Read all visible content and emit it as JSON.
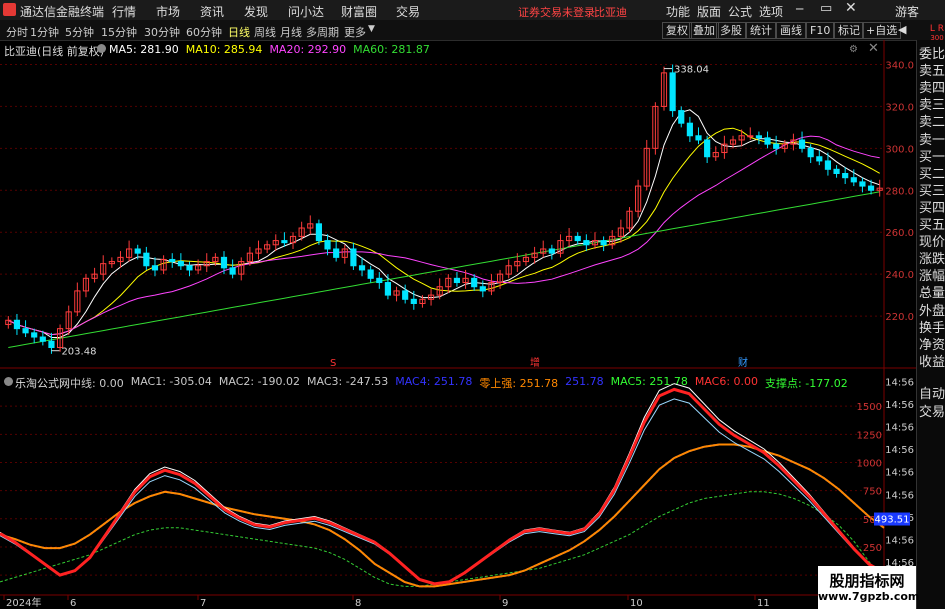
{
  "menu": {
    "app_title": "通达信金融终端",
    "items": [
      "行情",
      "市场",
      "资讯",
      "发现",
      "问小达",
      "财富圈",
      "交易"
    ],
    "notice": "证券交易未登录",
    "stock_name": "比亚迪",
    "right_items": [
      "功能",
      "版面",
      "公式",
      "选项"
    ],
    "guest": "游客",
    "lr_mark": "L R",
    "lr_num": "300"
  },
  "toolbar": {
    "timeframes": [
      "分时",
      "1分钟",
      "5分钟",
      "15分钟",
      "30分钟",
      "60分钟",
      "日线",
      "周线",
      "月线",
      "多周期",
      "更多"
    ],
    "active_timeframe": "日线",
    "buttons": [
      "复权",
      "叠加",
      "多股",
      "统计",
      "画线",
      "F10",
      "标记",
      "+自选"
    ],
    "back_label": "◀"
  },
  "price_panel": {
    "title": "比亚迪(日线 前复权)",
    "ma": [
      {
        "label": "MA5: 281.90",
        "color": "#ffffff"
      },
      {
        "label": "MA10: 285.94",
        "color": "#ffff00"
      },
      {
        "label": "MA20: 292.90",
        "color": "#ff44ff"
      },
      {
        "label": "MA60: 281.87",
        "color": "#33dd33"
      }
    ],
    "high_label": "338.04",
    "low_label": "203.48",
    "y_ticks": [
      "340.0",
      "320.0",
      "300.0",
      "280.0",
      "260.0",
      "240.0",
      "220.0"
    ],
    "markers": [
      "S",
      "增",
      "财"
    ]
  },
  "indicator_panel": {
    "title": "乐淘公式网",
    "items": [
      {
        "label": "中线: 0.00",
        "color": "#c8c8c8"
      },
      {
        "label": "MAC1: -305.04",
        "color": "#c8c8c8"
      },
      {
        "label": "MAC2: -190.02",
        "color": "#c8c8c8"
      },
      {
        "label": "MAC3: -247.53",
        "color": "#c8c8c8"
      },
      {
        "label": "MAC4: 251.78",
        "color": "#3333ff"
      },
      {
        "label": "零上强: 251.78",
        "color": "#ff8800"
      },
      {
        "label": "251.78",
        "color": "#3333ff"
      },
      {
        "label": "MAC5: 251.78",
        "color": "#33ff33"
      },
      {
        "label": "MAC6: 0.00",
        "color": "#ff3333"
      },
      {
        "label": "支撑点: -177.02",
        "color": "#33ff33"
      }
    ],
    "y_ticks": [
      "1500",
      "1250",
      "1000",
      "750",
      "500",
      "250",
      "0.00"
    ],
    "time_ticks": [
      "14:56",
      "14:56",
      "14:56",
      "14:56",
      "14:56",
      "14:56",
      "14:56",
      "14:56",
      "14:56"
    ],
    "cursor_value": "493.51"
  },
  "x_axis": {
    "labels": [
      "2024年",
      "6",
      "7",
      "8",
      "9",
      "10",
      "11"
    ]
  },
  "side_panel": {
    "top": [
      "委比",
      "卖五",
      "卖四",
      "卖三",
      "卖二",
      "卖一",
      "买一",
      "买二",
      "买三",
      "买四",
      "买五",
      "现价",
      "涨跌",
      "涨幅",
      "总量",
      "外盘",
      "换手",
      "净资",
      "收益"
    ],
    "bottom": [
      "自动",
      "交易"
    ]
  },
  "watermark": {
    "title": "股朋指标网",
    "url": "www.7gpzb.com"
  },
  "colors": {
    "up": "#ff3c3c",
    "down": "#00e5ff",
    "ma5": "#ffffff",
    "ma10": "#ffff00",
    "ma20": "#ff44ff",
    "ma60": "#33dd33",
    "accent": "#ff3333"
  },
  "chart_data": {
    "type": "candlestick",
    "y_range": [
      200,
      345
    ],
    "dates_approx": [
      "2024-05",
      "2024-06",
      "2024-07",
      "2024-08",
      "2024-09",
      "2024-10",
      "2024-11"
    ],
    "closes": [
      218,
      214,
      212,
      210,
      208,
      205,
      214,
      222,
      232,
      238,
      240,
      245,
      246,
      248,
      252,
      250,
      244,
      242,
      247,
      246,
      244,
      242,
      244,
      246,
      248,
      243,
      240,
      246,
      250,
      252,
      254,
      256,
      255,
      258,
      262,
      264,
      256,
      252,
      248,
      252,
      244,
      242,
      238,
      236,
      230,
      232,
      228,
      226,
      228,
      230,
      234,
      238,
      236,
      238,
      234,
      232,
      236,
      240,
      244,
      246,
      248,
      250,
      252,
      250,
      256,
      258,
      256,
      254,
      256,
      254,
      258,
      262,
      270,
      282,
      300,
      320,
      336,
      318,
      312,
      306,
      304,
      296,
      298,
      302,
      304,
      306,
      306,
      305,
      302,
      300,
      302,
      304,
      300,
      296,
      294,
      290,
      288,
      286,
      284,
      282,
      280,
      281
    ],
    "ma5_last": 281.9,
    "ma10_last": 285.94,
    "ma20_last": 292.9,
    "ma60_last": 281.87,
    "high": 338.04,
    "low": 203.48,
    "indicator": {
      "y_range": [
        -150,
        1750
      ],
      "mac1": [
        380,
        300,
        200,
        100,
        0,
        40,
        160,
        360,
        560,
        760,
        900,
        960,
        920,
        840,
        720,
        600,
        520,
        460,
        440,
        480,
        500,
        520,
        480,
        420,
        360,
        300,
        200,
        80,
        -40,
        -80,
        -60,
        20,
        120,
        220,
        320,
        400,
        420,
        400,
        380,
        420,
        560,
        780,
        1080,
        1400,
        1640,
        1700,
        1660,
        1520,
        1380,
        1280,
        1200,
        1120,
        1000,
        860,
        720,
        560,
        400,
        240,
        100,
        20
      ],
      "mac4": [
        360,
        320,
        270,
        240,
        240,
        280,
        360,
        460,
        560,
        640,
        700,
        740,
        720,
        680,
        640,
        600,
        570,
        540,
        520,
        500,
        480,
        450,
        400,
        320,
        220,
        100,
        20,
        -60,
        -100,
        -100,
        -80,
        -60,
        -40,
        -20,
        0,
        40,
        100,
        160,
        220,
        300,
        400,
        520,
        660,
        800,
        940,
        1040,
        1100,
        1140,
        1160,
        1160,
        1140,
        1100,
        1060,
        1000,
        940,
        860,
        760,
        640,
        520,
        420
      ],
      "support": [
        -60,
        -20,
        20,
        60,
        100,
        140,
        180,
        240,
        300,
        360,
        400,
        420,
        420,
        400,
        380,
        360,
        340,
        320,
        300,
        280,
        260,
        240,
        200,
        140,
        60,
        -20,
        -80,
        -100,
        -100,
        -80,
        -60,
        -40,
        -20,
        0,
        20,
        40,
        60,
        100,
        140,
        180,
        240,
        300,
        360,
        440,
        520,
        580,
        640,
        680,
        700,
        720,
        740,
        740,
        720,
        680,
        620,
        540,
        440,
        300,
        120,
        -40
      ]
    }
  }
}
